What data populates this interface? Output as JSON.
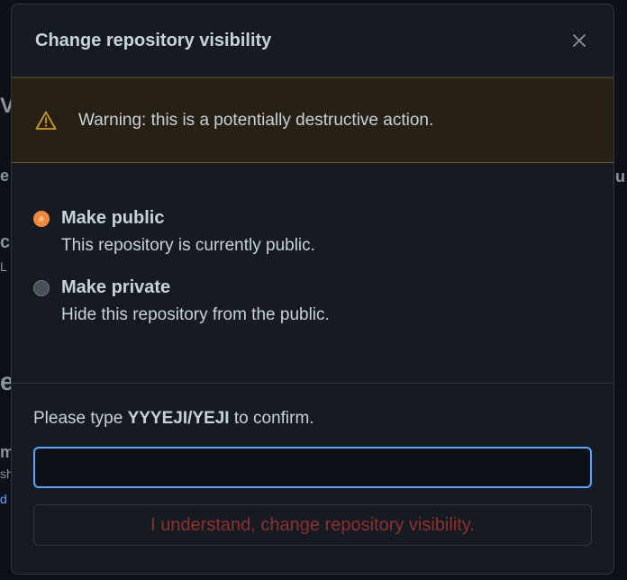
{
  "background": {
    "left_fragments": [
      "V",
      "e",
      "cl",
      "L",
      "e",
      "m",
      "sh",
      "d"
    ],
    "right_fragments": [
      "u"
    ]
  },
  "dialog": {
    "title": "Change repository visibility",
    "close_icon": "close-icon",
    "warning": {
      "icon": "alert-icon",
      "text": "Warning: this is a potentially destructive action."
    },
    "options": [
      {
        "label": "Make public",
        "description": "This repository is currently public.",
        "checked": true
      },
      {
        "label": "Make private",
        "description": "Hide this repository from the public.",
        "checked": false
      }
    ],
    "confirm": {
      "prompt_prefix": "Please type ",
      "repo_name": "YYYEJI/YEJI",
      "prompt_suffix": " to confirm.",
      "input_value": "",
      "input_placeholder": "",
      "button_label": "I understand, change repository visibility."
    }
  },
  "colors": {
    "accent_focus": "#58a6ff",
    "warning": "#d29922",
    "danger_disabled": "#8e2f2f",
    "radio_checked": "#f0883e"
  }
}
